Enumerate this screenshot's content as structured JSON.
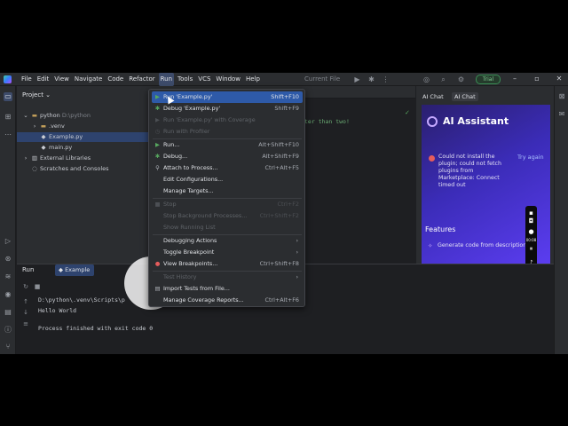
{
  "menubar": {
    "items": [
      "File",
      "Edit",
      "View",
      "Navigate",
      "Code",
      "Refactor",
      "Run",
      "Tools",
      "VCS",
      "Window",
      "Help"
    ],
    "active": "Run"
  },
  "toolbar": {
    "run_config": "Current File",
    "trial_label": "Trial"
  },
  "project": {
    "title": "Project",
    "root_name": "python",
    "root_path": "D:\\python",
    "venv": ".venv",
    "file_selected": "Example.py",
    "file_main": "main.py",
    "external_libraries": "External Libraries",
    "scratches": "Scratches and Consoles"
  },
  "editor": {
    "visible_code": "ter than two!"
  },
  "ai": {
    "tab_chat": "AI Chat",
    "tab_chat_selected": "AI Chat",
    "title": "AI Assistant",
    "error_message": "Could not install the plugin; could not fetch plugins from Marketplace: Connect timed out",
    "try_again": "Try again",
    "features_heading": "Features",
    "feature_item": "Generate code from description"
  },
  "recorder": {
    "time": "00:08"
  },
  "runpanel": {
    "title": "Run",
    "tab_label": "Example",
    "console_line1": "D:\\python\\.venv\\Scripts\\p",
    "console_line2": "Hello World",
    "console_line3": "Process finished with exit code 0"
  },
  "runmenu": {
    "items": [
      {
        "label": "Run 'Example.py'",
        "shortcut": "Shift+F10",
        "disabled": false,
        "highlighted": true,
        "icon": "play-icon"
      },
      {
        "label": "Debug 'Example.py'",
        "shortcut": "Shift+F9",
        "disabled": false,
        "icon": "bug-icon"
      },
      {
        "label": "Run 'Example.py' with Coverage",
        "shortcut": "",
        "disabled": true,
        "icon": "coverage-icon"
      },
      {
        "label": "Run with Profiler",
        "shortcut": "",
        "disabled": true,
        "icon": "profiler-icon"
      },
      {
        "label": "Run...",
        "shortcut": "Alt+Shift+F10",
        "disabled": false,
        "icon": "play-icon"
      },
      {
        "label": "Debug...",
        "shortcut": "Alt+Shift+F9",
        "disabled": false,
        "icon": "bug-icon"
      },
      {
        "label": "Attach to Process...",
        "shortcut": "Ctrl+Alt+F5",
        "disabled": false,
        "icon": "attach-icon"
      },
      {
        "label": "Edit Configurations...",
        "shortcut": "",
        "disabled": false,
        "icon": ""
      },
      {
        "label": "Manage Targets...",
        "shortcut": "",
        "disabled": false,
        "icon": ""
      },
      {
        "label": "Stop",
        "shortcut": "Ctrl+F2",
        "disabled": true,
        "icon": "stop-icon"
      },
      {
        "label": "Stop Background Processes...",
        "shortcut": "Ctrl+Shift+F2",
        "disabled": true,
        "icon": ""
      },
      {
        "label": "Show Running List",
        "shortcut": "",
        "disabled": true,
        "icon": ""
      },
      {
        "label": "Debugging Actions",
        "shortcut": "",
        "disabled": false,
        "submenu": true,
        "icon": ""
      },
      {
        "label": "Toggle Breakpoint",
        "shortcut": "",
        "disabled": false,
        "submenu": true,
        "icon": ""
      },
      {
        "label": "View Breakpoints...",
        "shortcut": "Ctrl+Shift+F8",
        "disabled": false,
        "icon": "breakpoint-icon"
      },
      {
        "label": "Test History",
        "shortcut": "",
        "disabled": true,
        "submenu": true,
        "icon": ""
      },
      {
        "label": "Import Tests from File...",
        "shortcut": "",
        "disabled": false,
        "icon": "import-icon"
      },
      {
        "label": "Manage Coverage Reports...",
        "shortcut": "Ctrl+Alt+F6",
        "disabled": false,
        "icon": ""
      }
    ]
  }
}
